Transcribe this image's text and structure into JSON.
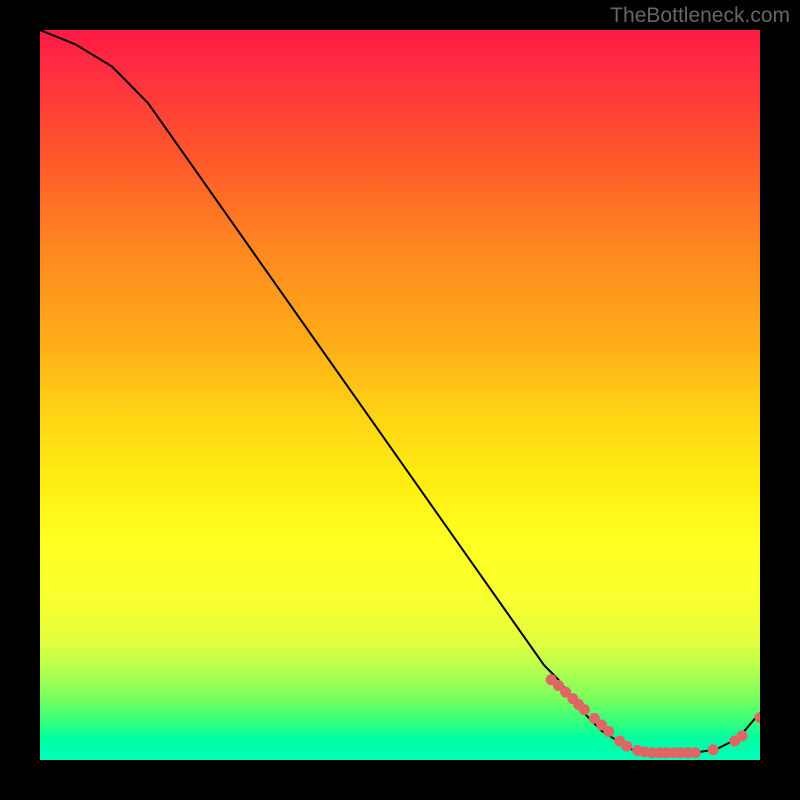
{
  "watermark": "TheBottleneck.com",
  "chart_data": {
    "type": "line",
    "title": "",
    "xlabel": "",
    "ylabel": "",
    "xlim": [
      0,
      100
    ],
    "ylim": [
      0,
      100
    ],
    "series": [
      {
        "name": "curve",
        "x": [
          0,
          5,
          10,
          15,
          20,
          25,
          30,
          35,
          40,
          45,
          50,
          55,
          60,
          65,
          70,
          72,
          75,
          78,
          82,
          85,
          88,
          91,
          94,
          97,
          100
        ],
        "y": [
          100,
          98,
          95,
          90,
          83,
          76,
          69,
          62,
          55,
          48,
          41,
          34,
          27,
          20,
          13,
          11,
          7,
          4,
          1.5,
          1,
          1,
          1,
          1.5,
          3,
          6.5
        ]
      }
    ],
    "markers": [
      {
        "x": 71.0,
        "y": 11.0
      },
      {
        "x": 72.0,
        "y": 10.2
      },
      {
        "x": 73.0,
        "y": 9.3
      },
      {
        "x": 74.0,
        "y": 8.4
      },
      {
        "x": 74.8,
        "y": 7.6
      },
      {
        "x": 75.6,
        "y": 6.9
      },
      {
        "x": 77.0,
        "y": 5.7
      },
      {
        "x": 78.0,
        "y": 4.8
      },
      {
        "x": 79.0,
        "y": 3.9
      },
      {
        "x": 80.5,
        "y": 2.6
      },
      {
        "x": 81.5,
        "y": 1.9
      },
      {
        "x": 83.0,
        "y": 1.3
      },
      {
        "x": 84.0,
        "y": 1.1
      },
      {
        "x": 85.0,
        "y": 1.0
      },
      {
        "x": 86.0,
        "y": 1.0
      },
      {
        "x": 87.0,
        "y": 1.0
      },
      {
        "x": 88.0,
        "y": 1.0
      },
      {
        "x": 89.0,
        "y": 1.0
      },
      {
        "x": 90.0,
        "y": 1.0
      },
      {
        "x": 91.0,
        "y": 1.0
      },
      {
        "x": 93.5,
        "y": 1.4
      },
      {
        "x": 96.5,
        "y": 2.6
      },
      {
        "x": 97.5,
        "y": 3.3
      },
      {
        "x": 100.0,
        "y": 5.8
      }
    ],
    "marker_color": "#e06666",
    "curve_color": "#000000"
  }
}
